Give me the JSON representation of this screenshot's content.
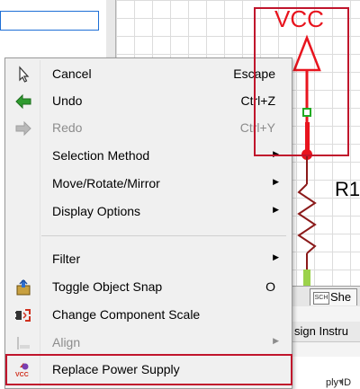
{
  "schematic": {
    "power_label": "VCC",
    "resistor_label": "R1"
  },
  "sheet_tab": {
    "icon_text": "SCH",
    "label": "She"
  },
  "lower_panel": {
    "header_fragment": "sign Instru",
    "row_fragment": "ply ID"
  },
  "context_menu": {
    "items": [
      {
        "label": "Cancel",
        "shortcut": "Escape",
        "icon": "pointer-arrow-icon",
        "enabled": true
      },
      {
        "label": "Undo",
        "shortcut": "Ctrl+Z",
        "icon": "undo-arrow-icon",
        "enabled": true
      },
      {
        "label": "Redo",
        "shortcut": "Ctrl+Y",
        "icon": "redo-arrow-icon",
        "enabled": false
      },
      {
        "label": "Selection Method",
        "shortcut": "",
        "submenu": true,
        "enabled": true
      },
      {
        "label": "Move/Rotate/Mirror",
        "shortcut": "",
        "submenu": true,
        "enabled": true
      },
      {
        "label": "Display Options",
        "shortcut": "",
        "submenu": true,
        "enabled": true
      },
      {
        "label": "Filter",
        "shortcut": "",
        "submenu": true,
        "enabled": true
      },
      {
        "label": "Toggle Object Snap",
        "shortcut": "O",
        "icon": "object-snap-icon",
        "enabled": true
      },
      {
        "label": "Change Component Scale",
        "shortcut": "",
        "icon": "component-scale-icon",
        "enabled": true
      },
      {
        "label": "Align",
        "shortcut": "",
        "submenu": true,
        "icon": "align-icon",
        "enabled": false
      },
      {
        "label": "Replace Power Supply",
        "shortcut": "",
        "icon": "vcc-power-icon",
        "enabled": true
      }
    ]
  },
  "colors": {
    "highlight": "#c0152c",
    "wire_red": "#e8141e",
    "resistor_brown": "#8b1a1a",
    "pin_green": "#22aa22",
    "undo_green": "#2f9b2f"
  }
}
